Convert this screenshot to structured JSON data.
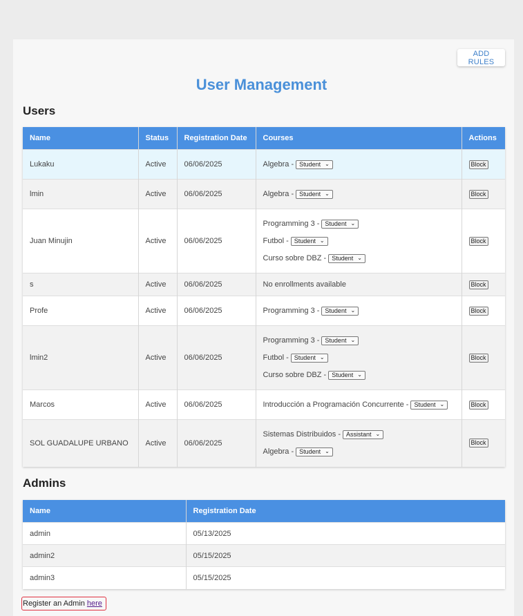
{
  "header": {
    "add_rules_label": "ADD RULES",
    "title": "User Management"
  },
  "users": {
    "section_title": "Users",
    "columns": [
      "Name",
      "Status",
      "Registration Date",
      "Courses",
      "Actions"
    ],
    "block_label": "Block",
    "rows": [
      {
        "name": "Lukaku",
        "status": "Active",
        "date": "06/06/2025",
        "courses": [
          {
            "course": "Algebra -",
            "role": "Student"
          }
        ]
      },
      {
        "name": "lmin",
        "status": "Active",
        "date": "06/06/2025",
        "courses": [
          {
            "course": "Algebra -",
            "role": "Student"
          }
        ]
      },
      {
        "name": "Juan Minujin",
        "status": "Active",
        "date": "06/06/2025",
        "courses": [
          {
            "course": "Programming 3 -",
            "role": "Student"
          },
          {
            "course": "Futbol -",
            "role": "Student"
          },
          {
            "course": "Curso sobre DBZ -",
            "role": "Student"
          }
        ]
      },
      {
        "name": "s",
        "status": "Active",
        "date": "06/06/2025",
        "no_courses": "No enrollments available"
      },
      {
        "name": "Profe",
        "status": "Active",
        "date": "06/06/2025",
        "courses": [
          {
            "course": "Programming 3 -",
            "role": "Student"
          }
        ]
      },
      {
        "name": "lmin2",
        "status": "Active",
        "date": "06/06/2025",
        "courses": [
          {
            "course": "Programming 3 -",
            "role": "Student"
          },
          {
            "course": "Futbol -",
            "role": "Student"
          },
          {
            "course": "Curso sobre DBZ -",
            "role": "Student"
          }
        ]
      },
      {
        "name": "Marcos",
        "status": "Active",
        "date": "06/06/2025",
        "courses": [
          {
            "course": "Introducción a Programación Concurrente -",
            "role": "Student"
          }
        ]
      },
      {
        "name": "SOL GUADALUPE URBANO",
        "status": "Active",
        "date": "06/06/2025",
        "courses": [
          {
            "course": "Sistemas Distribuidos -",
            "role": "Assistant"
          },
          {
            "course": "Algebra -",
            "role": "Student"
          }
        ]
      }
    ]
  },
  "admins": {
    "section_title": "Admins",
    "columns": [
      "Name",
      "Registration Date"
    ],
    "rows": [
      {
        "name": "admin",
        "date": "05/13/2025"
      },
      {
        "name": "admin2",
        "date": "05/15/2025"
      },
      {
        "name": "admin3",
        "date": "05/15/2025"
      }
    ]
  },
  "footer": {
    "register_text": "Register an Admin",
    "register_link": "here"
  },
  "colors": {
    "accent": "#4a90e2",
    "title": "#4a90d9",
    "highlight_row": "#e6f6fd",
    "register_border": "#e03040"
  }
}
